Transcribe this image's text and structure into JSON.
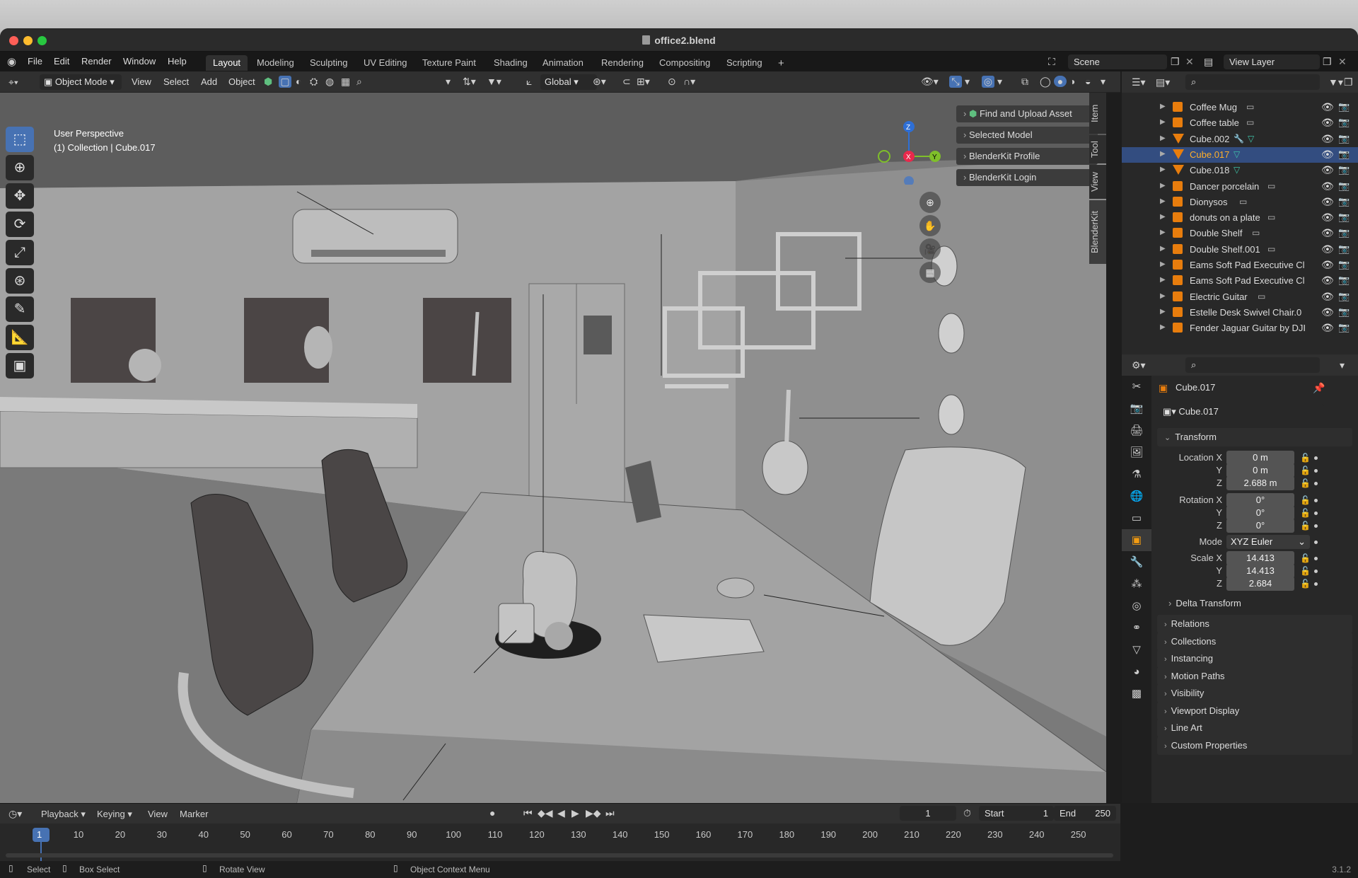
{
  "window": {
    "title": "office2.blend"
  },
  "menu": [
    "File",
    "Edit",
    "Render",
    "Window",
    "Help"
  ],
  "workspaces": [
    "Layout",
    "Modeling",
    "Sculpting",
    "UV Editing",
    "Texture Paint",
    "Shading",
    "Animation",
    "Rendering",
    "Compositing",
    "Scripting"
  ],
  "scene": "Scene",
  "view_layer": "View Layer",
  "viewport_header": {
    "mode": "Object Mode",
    "menus": [
      "View",
      "Select",
      "Add",
      "Object"
    ],
    "orientation": "Global"
  },
  "viewport": {
    "perspective": "User Perspective",
    "collection_info": "(1) Collection | Cube.017"
  },
  "npanel": {
    "panels": [
      "Find and Upload Asset",
      "Selected Model",
      "BlenderKit Profile",
      "BlenderKit Login"
    ],
    "tabs": [
      "Item",
      "Tool",
      "View",
      "BlenderKit"
    ]
  },
  "outliner": {
    "items": [
      {
        "name": "Coffee Mug",
        "selected": false
      },
      {
        "name": "Coffee table",
        "selected": false
      },
      {
        "name": "Cube.002",
        "selected": false
      },
      {
        "name": "Cube.017",
        "selected": true
      },
      {
        "name": "Cube.018",
        "selected": false
      },
      {
        "name": "Dancer porcelain",
        "selected": false
      },
      {
        "name": "Dionysos",
        "selected": false
      },
      {
        "name": "donuts on a plate",
        "selected": false
      },
      {
        "name": "Double Shelf",
        "selected": false
      },
      {
        "name": "Double Shelf.001",
        "selected": false
      },
      {
        "name": "Eams Soft Pad Executive Cl",
        "selected": false
      },
      {
        "name": "Eams Soft Pad Executive Cl",
        "selected": false
      },
      {
        "name": "Electric Guitar",
        "selected": false
      },
      {
        "name": "Estelle Desk Swivel Chair.0",
        "selected": false
      },
      {
        "name": "Fender Jaguar Guitar by DJI",
        "selected": false
      }
    ]
  },
  "properties": {
    "object_name": "Cube.017",
    "data_name": "Cube.017",
    "transform_label": "Transform",
    "location": {
      "label": "Location X",
      "x": "0 m",
      "y": "0 m",
      "z": "2.688 m"
    },
    "rotation": {
      "label": "Rotation X",
      "x": "0°",
      "y": "0°",
      "z": "0°"
    },
    "mode": {
      "label": "Mode",
      "value": "XYZ Euler"
    },
    "scale": {
      "label": "Scale X",
      "x": "14.413",
      "y": "14.413",
      "z": "2.684"
    },
    "axis_y": "Y",
    "axis_z": "Z",
    "delta_transform": "Delta Transform",
    "sections": [
      "Relations",
      "Collections",
      "Instancing",
      "Motion Paths",
      "Visibility",
      "Viewport Display",
      "Line Art",
      "Custom Properties"
    ]
  },
  "timeline": {
    "menus": [
      "Playback",
      "Keying",
      "View",
      "Marker"
    ],
    "current_frame": "1",
    "start_label": "Start",
    "start": "1",
    "end_label": "End",
    "end": "250",
    "ticks": [
      "1",
      "10",
      "20",
      "30",
      "40",
      "50",
      "60",
      "70",
      "80",
      "90",
      "100",
      "110",
      "120",
      "130",
      "140",
      "150",
      "160",
      "170",
      "180",
      "190",
      "200",
      "210",
      "220",
      "230",
      "240",
      "250"
    ]
  },
  "statusbar": {
    "select": "Select",
    "box_select": "Box Select",
    "rotate_view": "Rotate View",
    "context_menu": "Object Context Menu",
    "version": "3.1.2"
  },
  "colors": {
    "accent": "#4772b3",
    "selection": "#334d80",
    "active_text": "#ffaf29",
    "object_icon": "#e87d0d"
  }
}
